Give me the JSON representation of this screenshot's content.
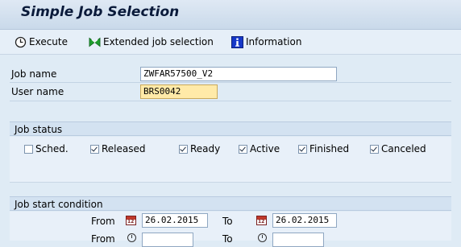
{
  "title": "Simple Job Selection",
  "toolbar": {
    "execute": "Execute",
    "extended": "Extended job selection",
    "information": "Information"
  },
  "fields": {
    "job_name_label": "Job name",
    "job_name_value": "ZWFAR57500_V2",
    "user_name_label": "User name",
    "user_name_value": "BRS0042"
  },
  "job_status": {
    "heading": "Job status",
    "items": [
      {
        "label": "Sched.",
        "checked": false
      },
      {
        "label": "Released",
        "checked": true
      },
      {
        "label": "Ready",
        "checked": true
      },
      {
        "label": "Active",
        "checked": true
      },
      {
        "label": "Finished",
        "checked": true
      },
      {
        "label": "Canceled",
        "checked": true
      }
    ]
  },
  "start_condition": {
    "heading": "Job start condition",
    "from_label": "From",
    "from_date": "26.02.2015",
    "to_label": "To",
    "to_date": "26.02.2015",
    "from_time_label": "From",
    "to_time_label": "To"
  },
  "colors": {
    "accent": "#0a1a3a",
    "required_field": "#ffeaa8"
  }
}
